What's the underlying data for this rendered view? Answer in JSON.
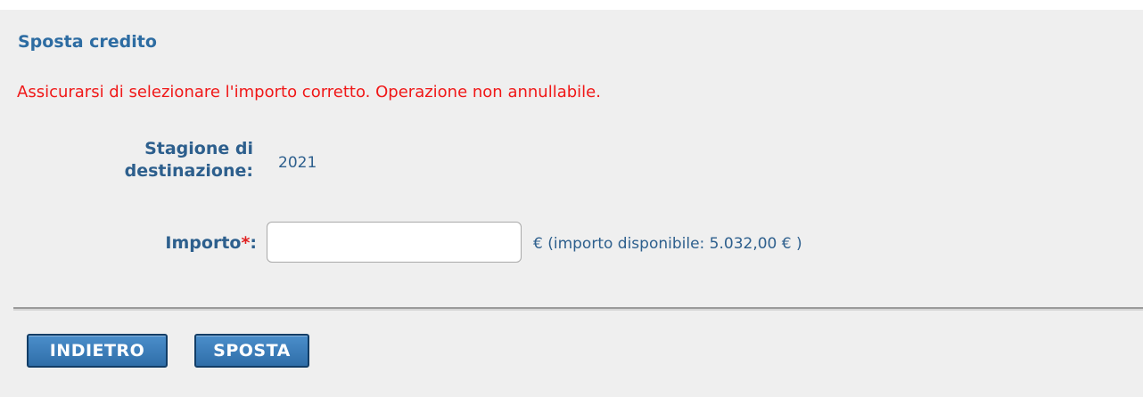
{
  "section": {
    "title": "Sposta credito",
    "warning": "Assicurarsi di selezionare l'importo corretto. Operazione non annullabile."
  },
  "form": {
    "season_label_line1": "Stagione di",
    "season_label_line2": "destinazione:",
    "season_value": "2021",
    "amount_label": "Importo",
    "required_marker": "*",
    "amount_label_colon": ":",
    "amount_value": "",
    "amount_placeholder": "",
    "available_text": "€ (importo disponibile: 5.032,00 € )"
  },
  "buttons": {
    "back_label": "INDIETRO",
    "move_label": "SPOSTA"
  },
  "colors": {
    "title": "#2d6ca2",
    "warning": "#f01818",
    "label": "#2d5f8d",
    "button_bg": "#3a7fbd",
    "panel_bg": "#efefef"
  }
}
